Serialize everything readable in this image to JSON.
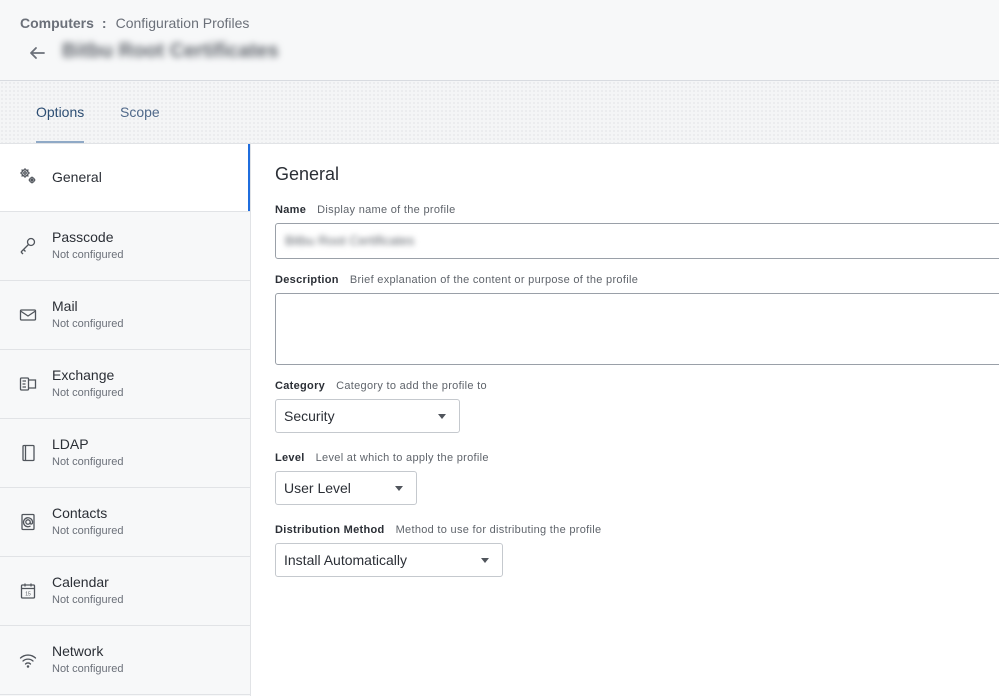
{
  "header": {
    "breadcrumb_root": "Computers",
    "breadcrumb_separator": ":",
    "breadcrumb_current": "Configuration Profiles",
    "page_title": "Bitbu Root Certificates",
    "back_icon": "back-arrow-icon"
  },
  "tabs": [
    {
      "label": "Options",
      "active": true
    },
    {
      "label": "Scope",
      "active": false
    }
  ],
  "sidebar": {
    "items": [
      {
        "label": "General",
        "sub": "",
        "icon": "gear-icon",
        "active": true
      },
      {
        "label": "Passcode",
        "sub": "Not configured",
        "icon": "key-icon"
      },
      {
        "label": "Mail",
        "sub": "Not configured",
        "icon": "envelope-icon"
      },
      {
        "label": "Exchange",
        "sub": "Not configured",
        "icon": "exchange-icon"
      },
      {
        "label": "LDAP",
        "sub": "Not configured",
        "icon": "ldap-book-icon"
      },
      {
        "label": "Contacts",
        "sub": "Not configured",
        "icon": "contacts-icon"
      },
      {
        "label": "Calendar",
        "sub": "Not configured",
        "icon": "calendar-icon"
      },
      {
        "label": "Network",
        "sub": "Not configured",
        "icon": "wifi-icon"
      }
    ]
  },
  "general": {
    "title": "General",
    "name": {
      "label": "Name",
      "hint": "Display name of the profile",
      "value": "Bitbu Root Certificates"
    },
    "description": {
      "label": "Description",
      "hint": "Brief explanation of the content or purpose of the profile",
      "value": ""
    },
    "category": {
      "label": "Category",
      "hint": "Category to add the profile to",
      "value": "Security"
    },
    "level": {
      "label": "Level",
      "hint": "Level at which to apply the profile",
      "value": "User Level"
    },
    "distribution": {
      "label": "Distribution Method",
      "hint": "Method to use for distributing the profile",
      "value": "Install Automatically"
    }
  },
  "colors": {
    "accent": "#1f6dde",
    "tab_active_text": "#2d4e73",
    "border": "#9aa0a8"
  }
}
